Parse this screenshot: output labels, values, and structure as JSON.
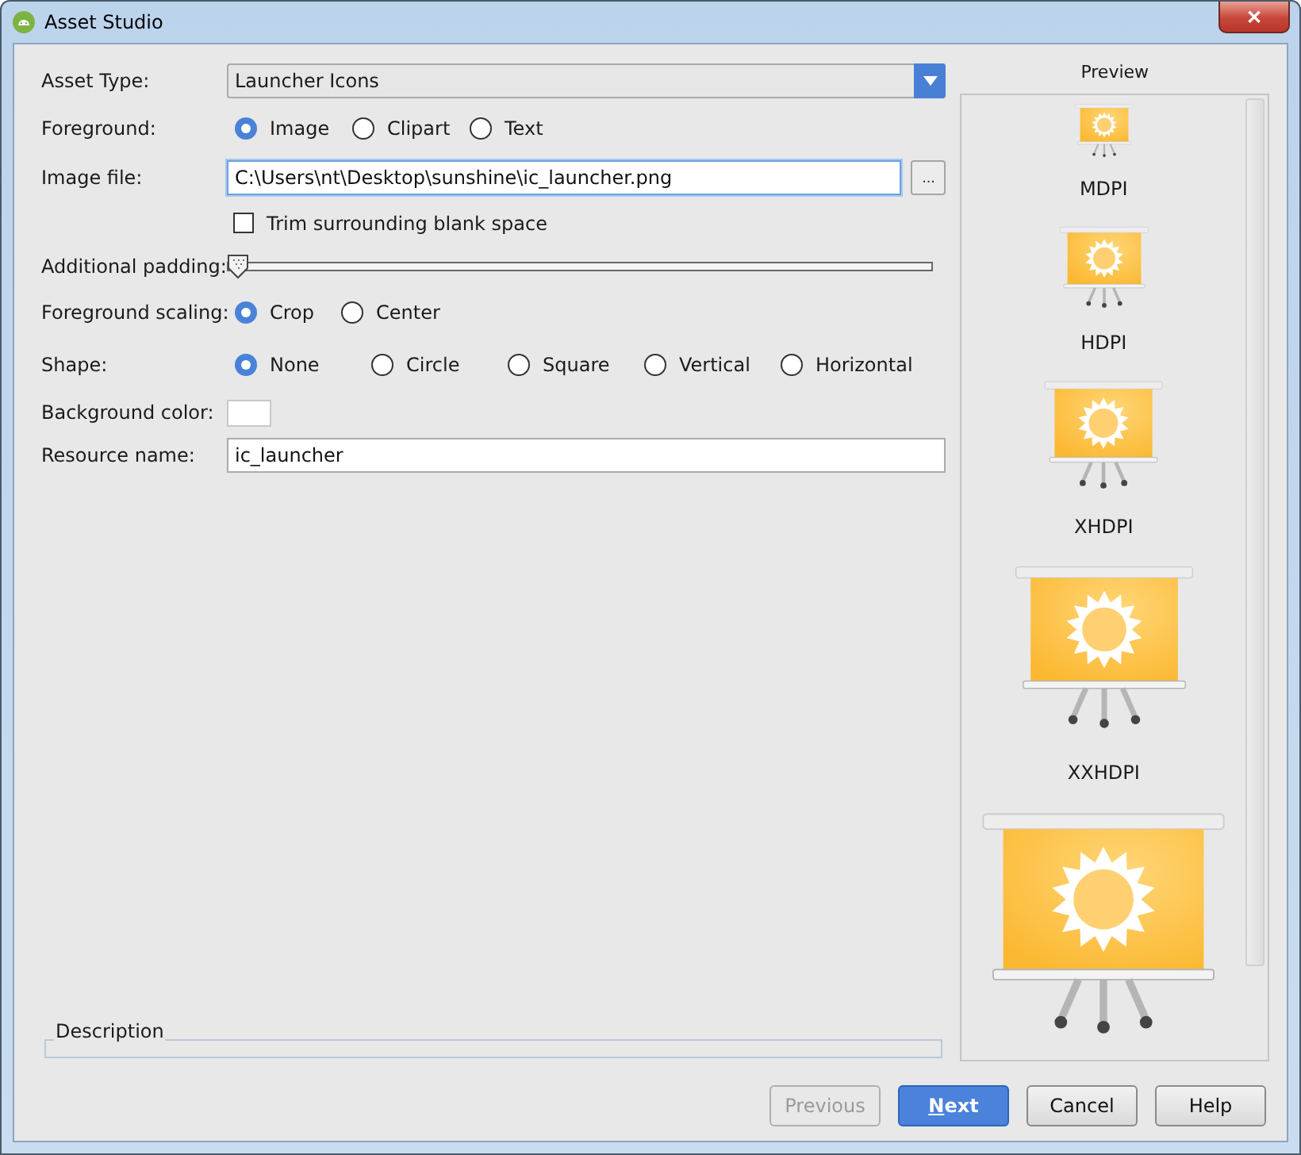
{
  "window": {
    "title": "Asset Studio",
    "close_glyph": "✕"
  },
  "form": {
    "asset_type": {
      "label": "Asset Type:",
      "value": "Launcher Icons"
    },
    "foreground": {
      "label": "Foreground:",
      "options": [
        {
          "label": "Image",
          "selected": true
        },
        {
          "label": "Clipart",
          "selected": false
        },
        {
          "label": "Text",
          "selected": false
        }
      ]
    },
    "image_file": {
      "label": "Image file:",
      "value": "C:\\Users\\nt\\Desktop\\sunshine\\ic_launcher.png",
      "browse": "..."
    },
    "trim": {
      "label": "Trim surrounding blank space",
      "checked": false
    },
    "padding": {
      "label": "Additional padding:",
      "level": 0
    },
    "scaling": {
      "label": "Foreground scaling:",
      "options": [
        {
          "label": "Crop",
          "selected": true
        },
        {
          "label": "Center",
          "selected": false
        }
      ]
    },
    "shape": {
      "label": "Shape:",
      "options": [
        {
          "label": "None",
          "selected": true
        },
        {
          "label": "Circle",
          "selected": false
        },
        {
          "label": "Square",
          "selected": false
        },
        {
          "label": "Vertical",
          "selected": false
        },
        {
          "label": "Horizontal",
          "selected": false
        }
      ]
    },
    "background_color": {
      "label": "Background color:",
      "color": "#ffffff"
    },
    "resource_name": {
      "label": "Resource name:",
      "value": "ic_launcher"
    }
  },
  "description": {
    "label": "Description"
  },
  "preview": {
    "title": "Preview",
    "items": [
      {
        "kind": "icon",
        "label": "MDPI"
      },
      {
        "kind": "icon",
        "label": "HDPI"
      },
      {
        "kind": "icon",
        "label": "XHDPI"
      },
      {
        "kind": "icon",
        "label": "XXHDPI"
      },
      {
        "kind": "icon"
      }
    ]
  },
  "buttons": [
    {
      "label": "Previous",
      "disabled": true,
      "default": false
    },
    {
      "label": "Next",
      "disabled": false,
      "default": true
    },
    {
      "label": "Cancel",
      "disabled": false,
      "default": false
    },
    {
      "label": "Help",
      "disabled": false,
      "default": false
    }
  ]
}
